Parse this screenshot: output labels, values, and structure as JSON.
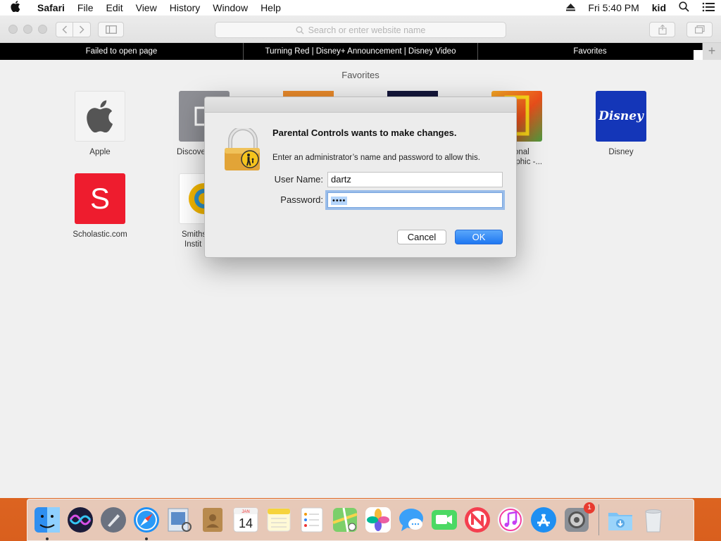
{
  "menubar": {
    "app": "Safari",
    "items": [
      "File",
      "Edit",
      "View",
      "History",
      "Window",
      "Help"
    ],
    "clock": "Fri 5:40 PM",
    "user": "kid"
  },
  "toolbar": {
    "address_placeholder": "Search or enter website name"
  },
  "tabs": [
    {
      "label": "Failed to open page"
    },
    {
      "label": "Turning Red | Disney+ Announcement | Disney Video"
    },
    {
      "label": "Favorites"
    }
  ],
  "new_tab_label": "+",
  "favorites": {
    "title": "Favorites",
    "items": [
      {
        "label": "Apple"
      },
      {
        "label": "Discove"
      },
      {
        "label": "onal"
      },
      {
        "label": "aphic -..."
      },
      {
        "label": "Disney"
      },
      {
        "label": "Scholastic.com"
      },
      {
        "label": "Smiths"
      },
      {
        "label": "Instit"
      }
    ],
    "tile_text": {
      "disney": "Disney",
      "scholastic": "S"
    }
  },
  "dialog": {
    "title": "Parental Controls wants to make changes.",
    "message": "Enter an administrator’s name and password to allow this.",
    "username_label": "User Name:",
    "username_value": "dartz",
    "password_label": "Password:",
    "password_value": "••••",
    "cancel_label": "Cancel",
    "ok_label": "OK"
  },
  "dock": {
    "calendar_month": "JAN",
    "calendar_day": "14",
    "system_prefs_badge": "1"
  }
}
